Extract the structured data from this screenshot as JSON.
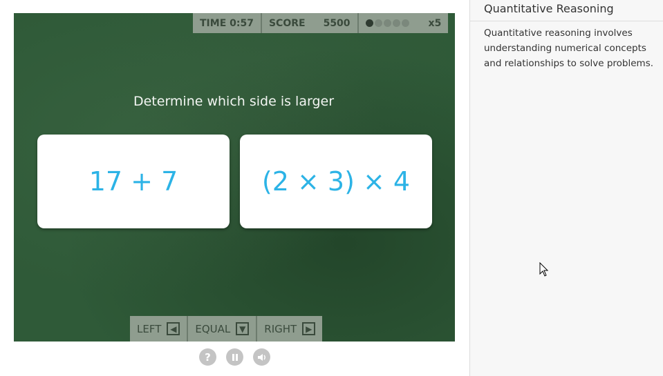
{
  "hud": {
    "time_label": "TIME",
    "time_value": "0:57",
    "score_label": "SCORE",
    "score_value": "5500",
    "multiplier": "x5",
    "dots_total": 5,
    "dots_filled": 1
  },
  "question": {
    "prompt": "Determine which side is larger",
    "left_expression": "17 + 7",
    "right_expression": "(2 × 3) × 4"
  },
  "answers": {
    "left_label": "LEFT",
    "equal_label": "EQUAL",
    "right_label": "RIGHT"
  },
  "controls": {
    "help_icon": "question-icon",
    "pause_icon": "pause-icon",
    "sound_icon": "speaker-icon"
  },
  "sidebar": {
    "title": "Quantitative Reasoning",
    "description": "Quantitative reasoning involves understanding numerical concepts and relationships to solve problems."
  },
  "colors": {
    "board": "#2f5a38",
    "card_text": "#2cb3e6",
    "hud_bg": "#8f9d8f"
  }
}
